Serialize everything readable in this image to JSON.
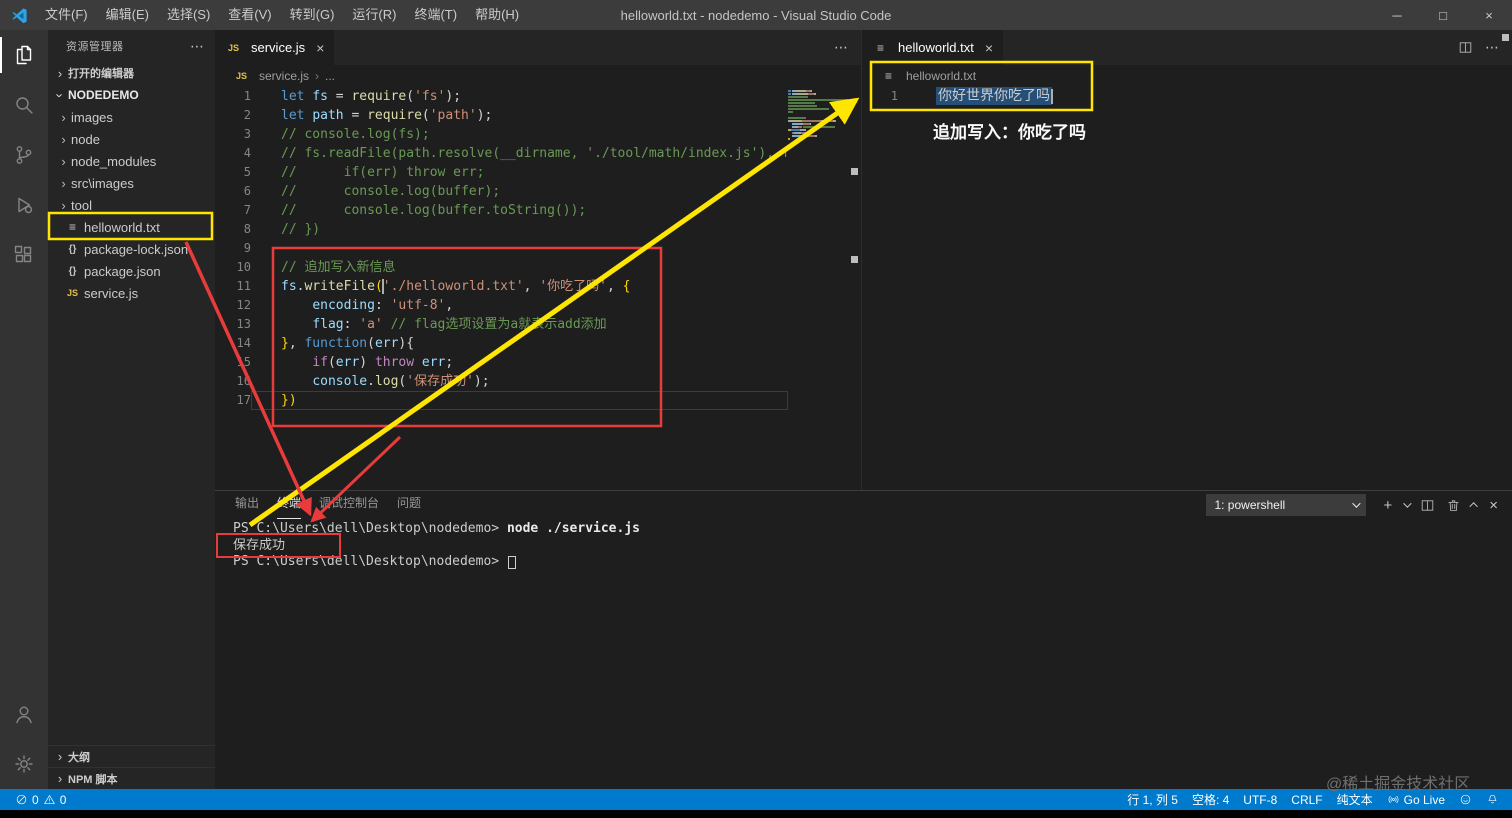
{
  "title_bar": {
    "title": "helloworld.txt - nodedemo - Visual Studio Code",
    "menus": [
      "文件(F)",
      "编辑(E)",
      "选择(S)",
      "查看(V)",
      "转到(G)",
      "运行(R)",
      "终端(T)",
      "帮助(H)"
    ],
    "window_controls": {
      "minimize": "─",
      "maximize": "□",
      "close": "×"
    }
  },
  "sidebar": {
    "header": "资源管理器",
    "open_editors": "打开的编辑器",
    "project": "NODEDEMO",
    "tree": [
      {
        "label": "images",
        "type": "folder"
      },
      {
        "label": "node",
        "type": "folder"
      },
      {
        "label": "node_modules",
        "type": "folder"
      },
      {
        "label": "src\\images",
        "type": "folder"
      },
      {
        "label": "tool",
        "type": "folder"
      },
      {
        "label": "helloworld.txt",
        "type": "txt"
      },
      {
        "label": "package-lock.json",
        "type": "json"
      },
      {
        "label": "package.json",
        "type": "json"
      },
      {
        "label": "service.js",
        "type": "js"
      }
    ],
    "outline": "大纲",
    "npm_scripts": "NPM 脚本"
  },
  "editor_left": {
    "tab": "service.js",
    "breadcrumb_file": "service.js",
    "breadcrumb_more": "...",
    "current_line": 17,
    "code_lines": [
      [
        [
          "kw",
          "let"
        ],
        [
          "pln",
          " "
        ],
        [
          "var",
          "fs"
        ],
        [
          "pln",
          " = "
        ],
        [
          "fn",
          "require"
        ],
        [
          "pln",
          "("
        ],
        [
          "str",
          "'fs'"
        ],
        [
          "pln",
          ");"
        ]
      ],
      [
        [
          "kw",
          "let"
        ],
        [
          "pln",
          " "
        ],
        [
          "var",
          "path"
        ],
        [
          "pln",
          " = "
        ],
        [
          "fn",
          "require"
        ],
        [
          "pln",
          "("
        ],
        [
          "str",
          "'path'"
        ],
        [
          "pln",
          ");"
        ]
      ],
      [
        [
          "cmt",
          "// console.log(fs);"
        ]
      ],
      [
        [
          "cmt",
          "// fs.readFile(path.resolve(__dirname, './tool/math/index.js'), function(err, buffer){"
        ]
      ],
      [
        [
          "cmt",
          "//      if(err) throw err;"
        ]
      ],
      [
        [
          "cmt",
          "//      console.log(buffer);"
        ]
      ],
      [
        [
          "cmt",
          "//      console.log(buffer.toString());"
        ]
      ],
      [
        [
          "cmt",
          "// })"
        ]
      ],
      [],
      [
        [
          "cmt",
          "// 追加写入新信息"
        ]
      ],
      [
        [
          "var",
          "fs"
        ],
        [
          "pln",
          "."
        ],
        [
          "fn",
          "writeFile"
        ],
        [
          "brc",
          "("
        ],
        [
          "cur",
          ""
        ],
        [
          "str",
          "'./helloworld.txt'"
        ],
        [
          "pln",
          ", "
        ],
        [
          "str",
          "'你吃了吗'"
        ],
        [
          "pln",
          ", "
        ],
        [
          "brc",
          "{"
        ]
      ],
      [
        [
          "pln",
          "    "
        ],
        [
          "var",
          "encoding"
        ],
        [
          "pln",
          ": "
        ],
        [
          "str",
          "'utf-8'"
        ],
        [
          "pln",
          ","
        ]
      ],
      [
        [
          "pln",
          "    "
        ],
        [
          "var",
          "flag"
        ],
        [
          "pln",
          ": "
        ],
        [
          "str",
          "'a'"
        ],
        [
          "pln",
          " "
        ],
        [
          "cmt",
          "// flag选项设置为a就表示add添加"
        ]
      ],
      [
        [
          "brc",
          "}"
        ],
        [
          "pln",
          ", "
        ],
        [
          "kw",
          "function"
        ],
        [
          "pln",
          "("
        ],
        [
          "var",
          "err"
        ],
        [
          "pln",
          "){"
        ]
      ],
      [
        [
          "pln",
          "    "
        ],
        [
          "ctrl",
          "if"
        ],
        [
          "pln",
          "("
        ],
        [
          "var",
          "err"
        ],
        [
          "pln",
          ") "
        ],
        [
          "ctrl",
          "throw"
        ],
        [
          "pln",
          " "
        ],
        [
          "var",
          "err"
        ],
        [
          "pln",
          ";"
        ]
      ],
      [
        [
          "pln",
          "    "
        ],
        [
          "var",
          "console"
        ],
        [
          "pln",
          "."
        ],
        [
          "fn",
          "log"
        ],
        [
          "pln",
          "("
        ],
        [
          "str",
          "'保存成功'"
        ],
        [
          "pln",
          ");"
        ]
      ],
      [
        [
          "brc",
          "})"
        ]
      ]
    ]
  },
  "editor_right": {
    "tab": "helloworld.txt",
    "breadcrumb_file": "helloworld.txt",
    "line_number": "1",
    "content": "你好世界你吃了吗"
  },
  "panel": {
    "tabs": [
      "输出",
      "终端",
      "调试控制台",
      "问题"
    ],
    "active_tab": "终端",
    "shell": "1: powershell",
    "terminal_lines": [
      [
        [
          "prompt",
          "PS C:\\Users\\dell\\Desktop\\nodedemo> "
        ],
        [
          "command",
          "node ./service.js"
        ]
      ],
      [
        [
          "output",
          "保存成功"
        ]
      ],
      [
        [
          "prompt",
          "PS C:\\Users\\dell\\Desktop\\nodedemo> "
        ],
        [
          "cursor",
          ""
        ]
      ]
    ]
  },
  "status_bar": {
    "errors": "0",
    "warnings": "0",
    "cursor": "行 1, 列 5",
    "indent": "空格: 4",
    "encoding": "UTF-8",
    "eol": "CRLF",
    "language": "纯文本",
    "go_live": "Go Live"
  },
  "annotations": {
    "note": "追加写入：你吃了吗"
  },
  "watermark": "@稀土掘金技术社区",
  "colors": {
    "status_bar": "#007acc",
    "annotation_yellow": "#ffe600",
    "annotation_red": "#e83c3c",
    "selection": "#264f78"
  }
}
